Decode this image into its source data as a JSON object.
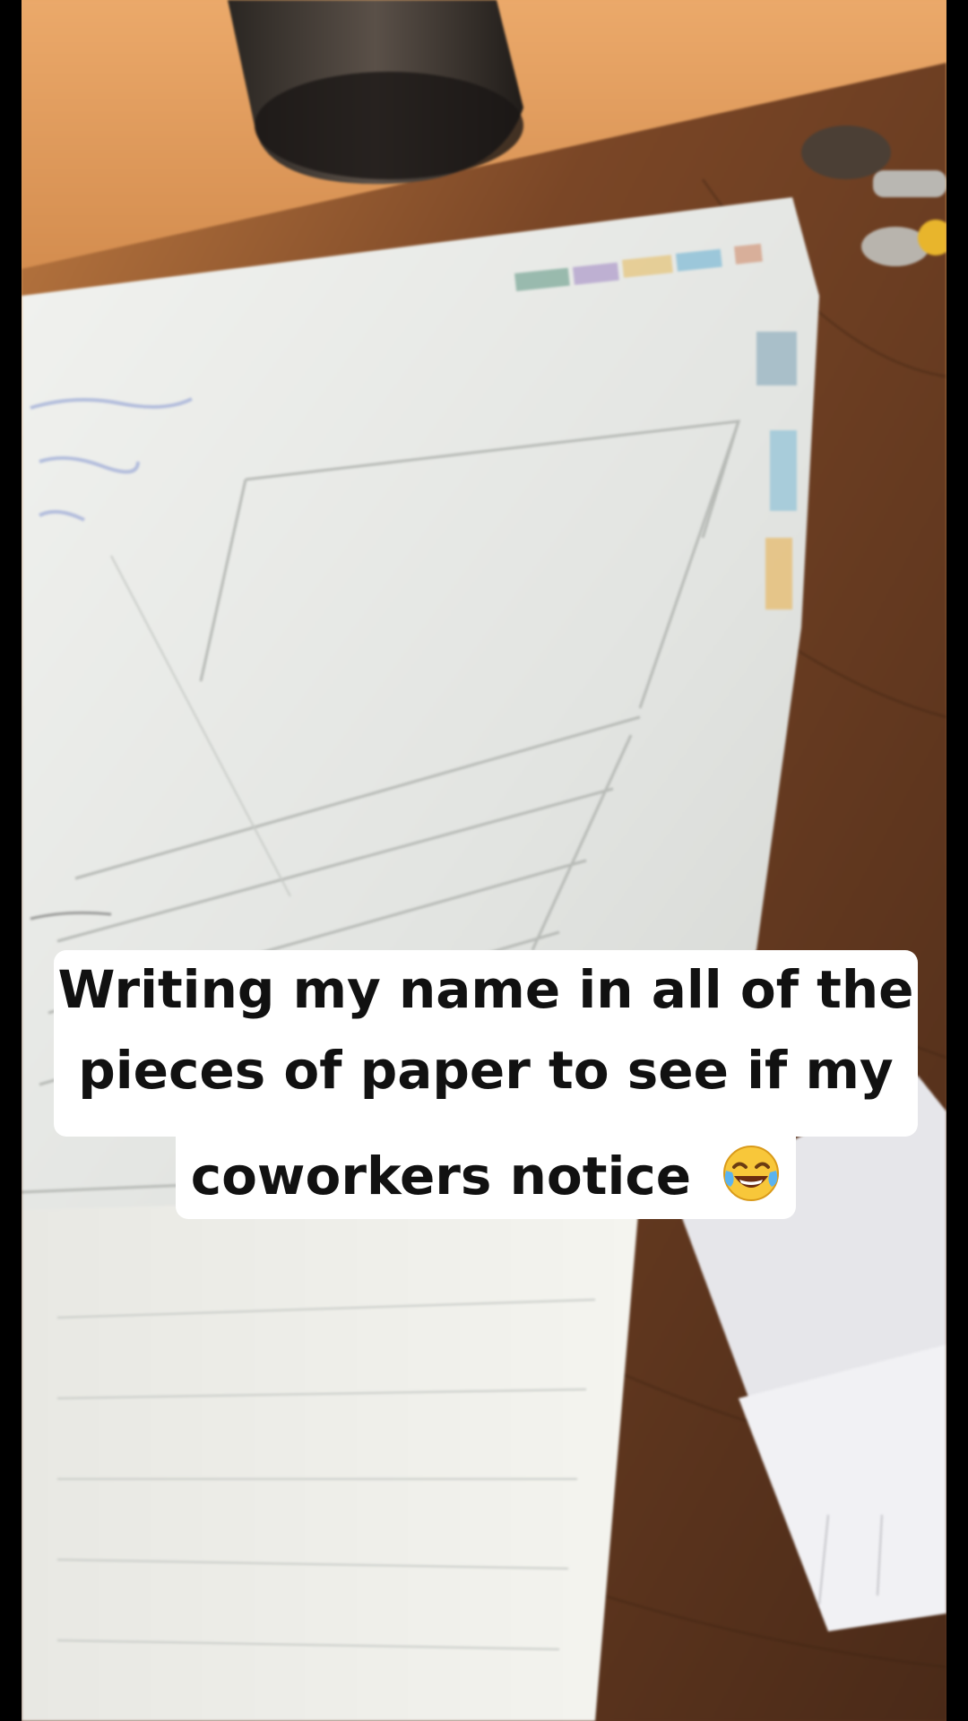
{
  "caption": {
    "line1": "Writing my name in all of the",
    "line2": "pieces of paper to see if my",
    "line3": "coworkers notice",
    "emoji": "face-with-tears-of-joy-icon"
  },
  "colors": {
    "caption_background": "#ffffff",
    "caption_text": "#111111",
    "desk": "#6b3d22",
    "paper": "#e9ebe8"
  }
}
